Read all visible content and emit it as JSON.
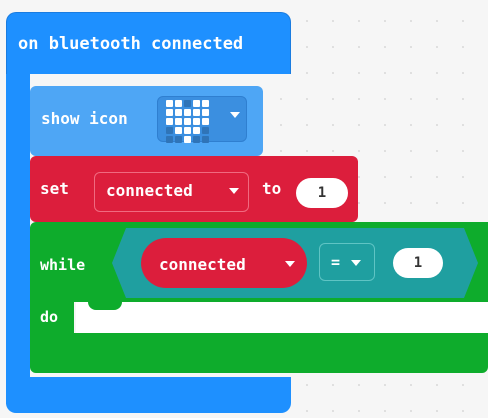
{
  "hat": {
    "label": "on bluetooth connected",
    "color": "#1E90FF"
  },
  "show_icon": {
    "label": "show icon",
    "icon_name": "heart-icon",
    "pattern": [
      [
        1,
        1,
        0,
        1,
        1
      ],
      [
        1,
        1,
        1,
        1,
        1
      ],
      [
        1,
        1,
        1,
        1,
        1
      ],
      [
        0,
        1,
        1,
        1,
        0
      ],
      [
        0,
        0,
        1,
        0,
        0
      ]
    ],
    "color": "#4EA6F5"
  },
  "set_block": {
    "label": "set",
    "variable": "connected",
    "to_label": "to",
    "value": "1",
    "color": "#DC1E3C"
  },
  "while_block": {
    "label": "while",
    "do_label": "do",
    "condition": {
      "left": "connected",
      "operator": "=",
      "right": "1"
    },
    "color": "#0EAC2C",
    "logic_color": "#1F9FA0"
  }
}
